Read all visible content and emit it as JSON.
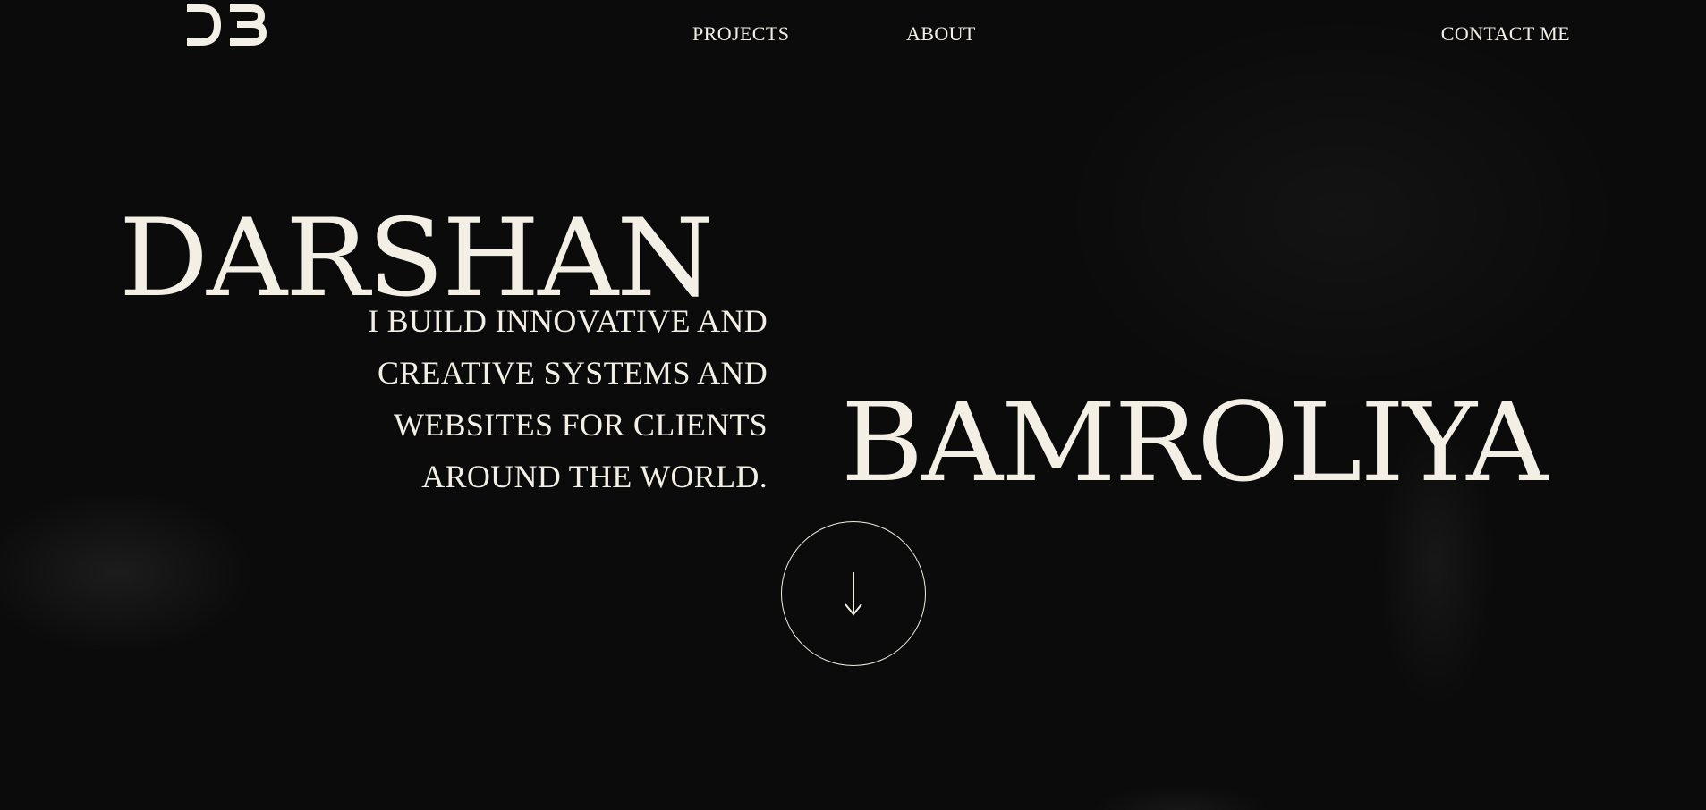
{
  "brand": {
    "logo_text": "DB",
    "logo_icon": "db-monogram-logo"
  },
  "nav": {
    "items": [
      {
        "label": "PROJECTS"
      },
      {
        "label": "ABOUT"
      }
    ],
    "contact_label": "CONTACT ME"
  },
  "hero": {
    "first_name": "DARSHAN",
    "last_name": "BAMROLIYA",
    "tagline_lines": [
      "I BUILD INNOVATIVE AND",
      "CREATIVE SYSTEMS AND",
      "WEBSITES FOR CLIENTS",
      "AROUND THE WORLD."
    ],
    "scroll_icon": "arrow-down-icon"
  },
  "colors": {
    "background": "#0b0b0b",
    "text": "#f3efe4"
  }
}
